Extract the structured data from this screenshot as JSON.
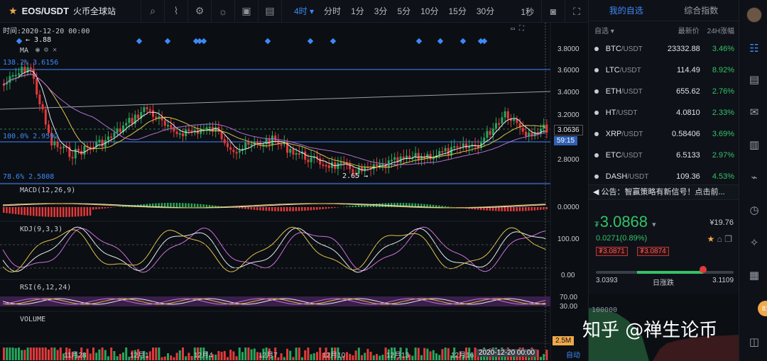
{
  "toolbar": {
    "symbol": "EOS/USDT",
    "exchange": "火币全球站",
    "intervals": [
      "分时",
      "1分",
      "3分",
      "5分",
      "10分",
      "15分",
      "30分"
    ],
    "active_interval": "4时",
    "refresh": "1秒"
  },
  "chart": {
    "time_label": "时间:2020-12-20 00:00",
    "high_marker": "3.88",
    "low_marker": "2.65",
    "ma_label": "MA",
    "fib_138": "138.2%  3.6156",
    "fib_100": "100.0%  2.9592",
    "fib_786": "78.6%  2.5808",
    "price_axis": [
      "3.8000",
      "3.6000",
      "3.4000",
      "3.2000",
      "3.0000",
      "2.8000"
    ],
    "last_price": "3.0636",
    "countdown": "59:15",
    "macd_label": "MACD(12,26,9)",
    "macd_axis": "0.0000",
    "kdj_label": "KDJ(9,3,3)",
    "kdj_axis": [
      "100.00",
      "0.00"
    ],
    "rsi_label": "RSI(6,12,24)",
    "rsi_axis": [
      "70.00",
      "30.00"
    ],
    "volume_label": "VOLUME",
    "volume_tag": "2.5M",
    "dates": [
      "11月28",
      "12月1",
      "12月4",
      "12月7",
      "12月10",
      "12月13",
      "12月16"
    ],
    "cursor_date": "2020-12-20 00:00",
    "auto": "自动",
    "colors": {
      "up": "#26a65b",
      "down": "#e23a3a",
      "accent": "#3d8af7",
      "fib": "#2f5fb3"
    }
  },
  "panel": {
    "tabs": [
      "我的自选",
      "综合指数"
    ],
    "head": {
      "col1": "自选",
      "col2": "最新价",
      "col3": "24H涨幅"
    },
    "rows": [
      {
        "base": "BTC",
        "quote": "/USDT",
        "price": "23332.88",
        "change": "3.46%"
      },
      {
        "base": "LTC",
        "quote": "/USDT",
        "price": "114.49",
        "change": "8.92%"
      },
      {
        "base": "ETH",
        "quote": "/USDT",
        "price": "655.62",
        "change": "2.76%"
      },
      {
        "base": "HT",
        "quote": "/USDT",
        "price": "4.0810",
        "change": "2.33%"
      },
      {
        "base": "XRP",
        "quote": "/USDT",
        "price": "0.58406",
        "change": "3.69%"
      },
      {
        "base": "ETC",
        "quote": "/USDT",
        "price": "6.5133",
        "change": "2.97%"
      },
      {
        "base": "DASH",
        "quote": "/USDT",
        "price": "109.36",
        "change": "4.53%"
      }
    ],
    "notice": "公告：智赢策略有新信号！点击前...",
    "price": "3.0868",
    "currency": "₮",
    "usd": "¥19.76",
    "change": "0.0271(0.89%)",
    "bid": "₮3.0871",
    "ask": "₮3.0874",
    "range_low": "3.0393",
    "range_mid": "日涨跌",
    "range_high": "3.1109",
    "range_level": 0.78,
    "depth_value": "100000"
  },
  "watermark": "知乎 @禅生论币",
  "badge": "81"
}
